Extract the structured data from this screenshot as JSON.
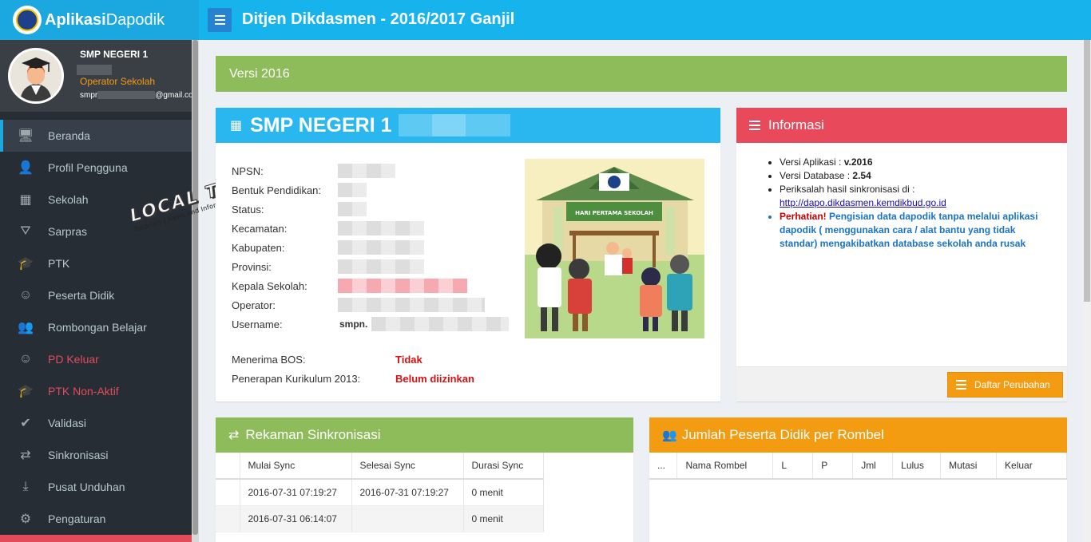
{
  "app": {
    "brand_bold": "Aplikasi",
    "brand_light": "Dapodik",
    "title": "Ditjen Dikdasmen - 2016/2017 Ganjil"
  },
  "user": {
    "school": "SMP NEGERI 1",
    "role": "Operator Sekolah",
    "email_prefix": "smpr",
    "email_suffix": "@gmail.co"
  },
  "menu": [
    {
      "label": "Beranda",
      "icon": "monitor-icon",
      "glyph": "🖥",
      "active": true,
      "red": false
    },
    {
      "label": "Profil Pengguna",
      "icon": "user-icon",
      "glyph": "👤",
      "active": false,
      "red": false
    },
    {
      "label": "Sekolah",
      "icon": "building-icon",
      "glyph": "▦",
      "active": false,
      "red": false
    },
    {
      "label": "Sarpras",
      "icon": "road-icon",
      "glyph": "⛛",
      "active": false,
      "red": false
    },
    {
      "label": "PTK",
      "icon": "graduation-cap-icon",
      "glyph": "🎓",
      "active": false,
      "red": false
    },
    {
      "label": "Peserta Didik",
      "icon": "smile-icon",
      "glyph": "☺",
      "active": false,
      "red": false
    },
    {
      "label": "Rombongan Belajar",
      "icon": "users-icon",
      "glyph": "👥",
      "active": false,
      "red": false
    },
    {
      "label": "PD Keluar",
      "icon": "smile-icon",
      "glyph": "☺",
      "active": false,
      "red": true
    },
    {
      "label": "PTK Non-Aktif",
      "icon": "graduation-cap-icon",
      "glyph": "🎓",
      "active": false,
      "red": true
    },
    {
      "label": "Validasi",
      "icon": "check-icon",
      "glyph": "✔",
      "active": false,
      "red": false
    },
    {
      "label": "Sinkronisasi",
      "icon": "exchange-icon",
      "glyph": "⇄",
      "active": false,
      "red": false
    },
    {
      "label": "Pusat Unduhan",
      "icon": "download-icon",
      "glyph": "⤓",
      "active": false,
      "red": false
    },
    {
      "label": "Pengaturan",
      "icon": "gear-icon",
      "glyph": "⚙",
      "active": false,
      "red": false
    }
  ],
  "watermark": {
    "title": "LOCAL TECHNO",
    "tagline": "Tutorials | News and Information Disclosure"
  },
  "version_bar": "Versi 2016",
  "school_box": {
    "title": "SMP NEGERI 1",
    "rows": [
      {
        "label": "NPSN:",
        "redact": "pix"
      },
      {
        "label": "Bentuk Pendidikan:",
        "redact": "pix"
      },
      {
        "label": "Status:",
        "redact": "pix"
      },
      {
        "label": "Kecamatan:",
        "redact": "pix"
      },
      {
        "label": "Kabupaten:",
        "redact": "pix"
      },
      {
        "label": "Provinsi:",
        "redact": "pix"
      },
      {
        "label": "Kepala Sekolah:",
        "redact": "pix-red"
      },
      {
        "label": "Operator:",
        "redact": "pix"
      },
      {
        "label": "Username:",
        "redact": "user"
      }
    ],
    "username_prefix": "smpn.",
    "bos_label": "Menerima BOS:",
    "bos_value": "Tidak",
    "kurikulum_label": "Penerapan Kurikulum 2013:",
    "kurikulum_value": "Belum diizinkan",
    "image_caption": "HARI PERTAMA SEKOLAH"
  },
  "info_box": {
    "title": "Informasi",
    "items": {
      "versi_aplikasi_label": "Versi Aplikasi : ",
      "versi_aplikasi_value": "v.2016",
      "versi_db_label": "Versi Database : ",
      "versi_db_value": "2.54",
      "periksa_label": "Periksalah hasil sinkronisasi di :",
      "periksa_link": "http://dapo.dikdasmen.kemdikbud.go.id",
      "perhatian_label": "Perhatian!",
      "perhatian_text": " Pengisian data dapodik tanpa melalui aplikasi dapodik ( menggunakan cara / alat bantu yang tidak standar) mengakibatkan database sekolah anda rusak"
    },
    "button": "Daftar Perubahan"
  },
  "sync_box": {
    "title": "Rekaman Sinkronisasi",
    "columns": [
      "",
      "Mulai Sync",
      "Selesai Sync",
      "Durasi Sync"
    ],
    "rows": [
      [
        "",
        "2016-07-31 07:19:27",
        "2016-07-31 07:19:27",
        "0 menit"
      ],
      [
        "",
        "2016-07-31 06:14:07",
        "",
        "0 menit"
      ]
    ]
  },
  "rombel_box": {
    "title": "Jumlah Peserta Didik per Rombel",
    "columns": [
      "...",
      "Nama Rombel",
      "L",
      "P",
      "Jml",
      "Lulus",
      "Mutasi",
      "Keluar"
    ]
  },
  "colors": {
    "topbar": "#17b3ec",
    "sidebar": "#262d35",
    "green": "#8fbc5a",
    "red": "#e84a5b",
    "orange": "#f39c12",
    "blue": "#2ab6ef"
  }
}
